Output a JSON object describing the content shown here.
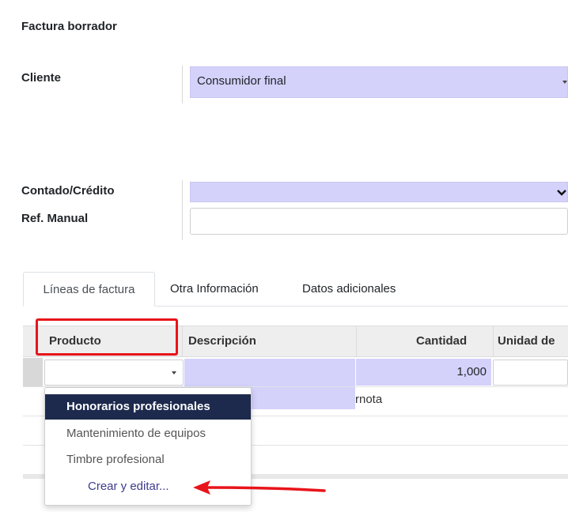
{
  "form": {
    "title": "Factura borrador",
    "cliente_label": "Cliente",
    "cliente_value": "Consumidor final",
    "contado_label": "Contado/Crédito",
    "contado_value": "",
    "ref_label": "Ref. Manual",
    "ref_value": ""
  },
  "tabs": [
    {
      "label": "Líneas de factura"
    },
    {
      "label": "Otra Información"
    },
    {
      "label": "Datos adicionales"
    }
  ],
  "table": {
    "columns": [
      "Producto",
      "Descripción",
      "Cantidad",
      "Unidad de"
    ],
    "row": {
      "producto": "",
      "descripcion": "",
      "cantidad": "1,000",
      "unidad": ""
    },
    "add_note_fragment": "nota"
  },
  "dropdown": {
    "items": [
      {
        "label": "Honorarios profesionales"
      },
      {
        "label": "Mantenimiento de equipos"
      },
      {
        "label": "Timbre profesional"
      }
    ],
    "create_label": "Crear y editar..."
  },
  "colors": {
    "highlight": "#e8141a",
    "selected_item": "#1d2a4d",
    "field_fill": "#d4d2fb"
  }
}
